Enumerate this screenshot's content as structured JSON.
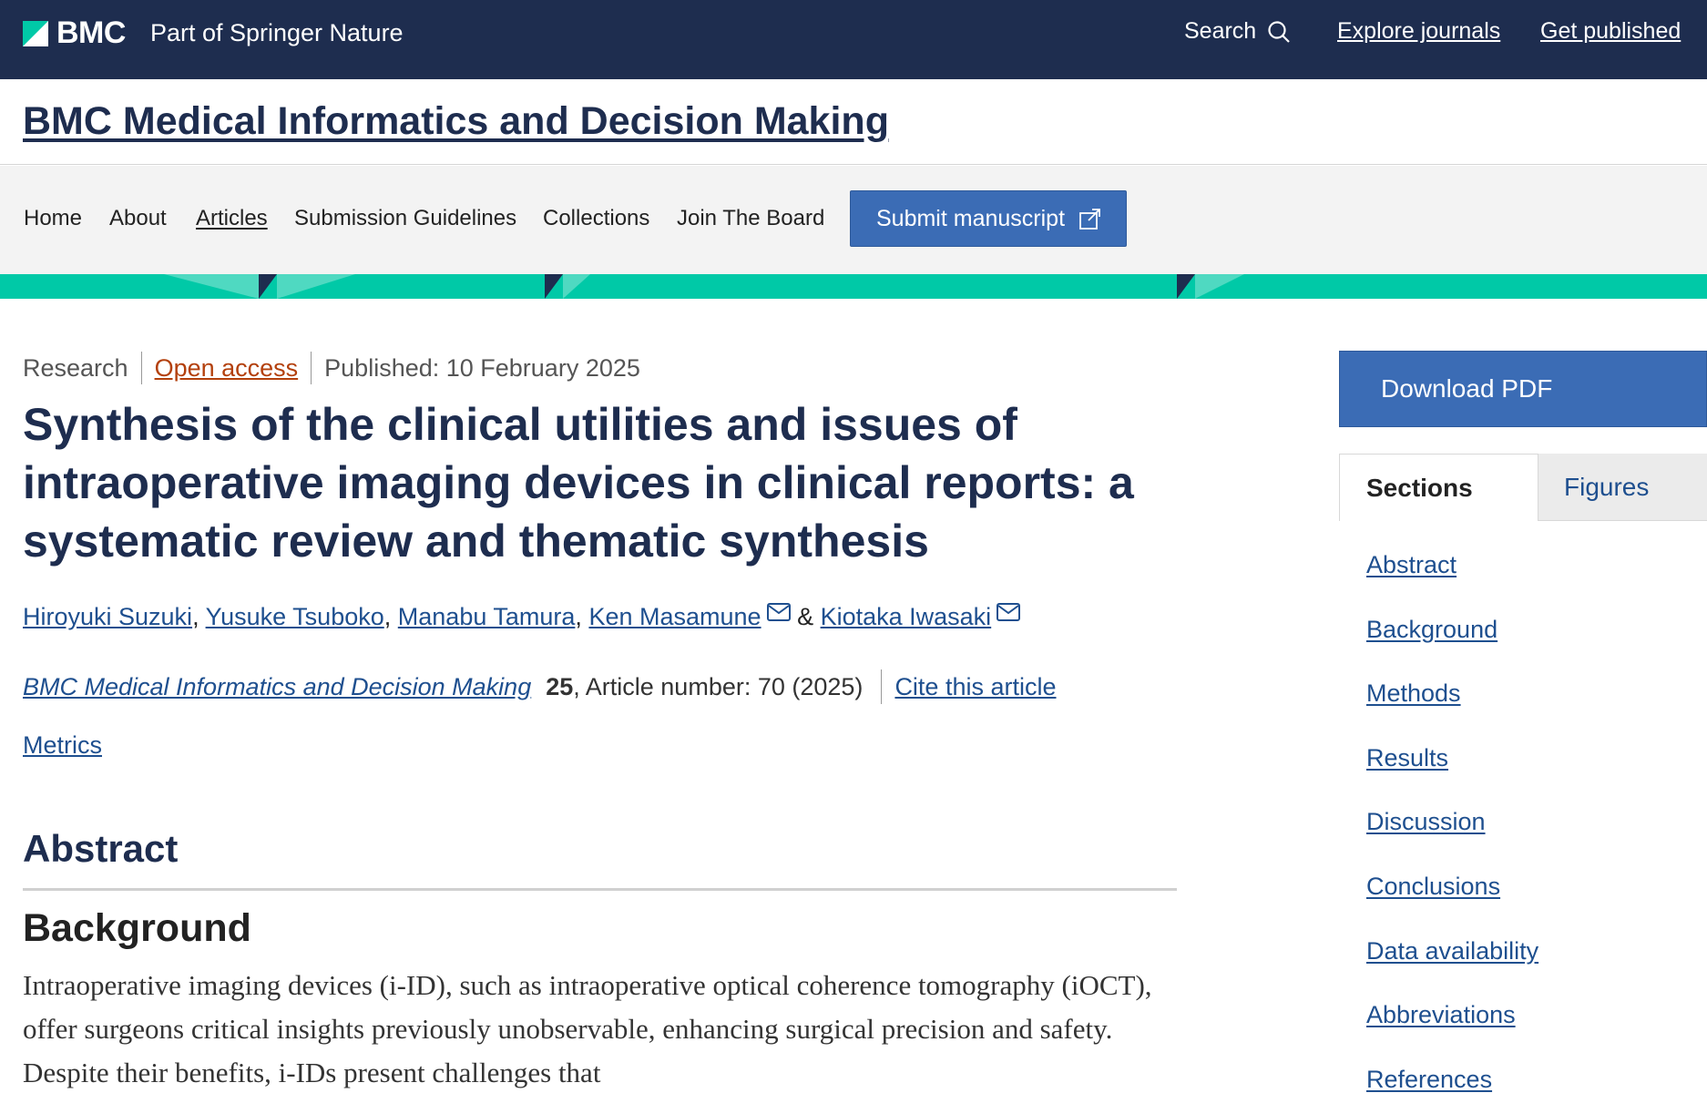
{
  "topbar": {
    "brand": "BMC",
    "tagline": "Part of Springer Nature",
    "search_label": "Search",
    "links": [
      "Explore journals",
      "Get published"
    ]
  },
  "journal": {
    "title": "BMC Medical Informatics and Decision Making"
  },
  "nav": {
    "items": [
      "Home",
      "About",
      "Articles",
      "Submission Guidelines",
      "Collections",
      "Join The Board"
    ],
    "active": "Articles",
    "submit_label": "Submit manuscript"
  },
  "article": {
    "type": "Research",
    "access": "Open access",
    "published": "Published: 10 February 2025",
    "title": "Synthesis of the clinical utilities and issues of intraoperative imaging devices in clinical reports: a systematic review and thematic synthesis",
    "authors": [
      "Hiroyuki Suzuki",
      "Yusuke Tsuboko",
      "Manabu Tamura",
      "Ken Masamune",
      "Kiotaka Iwasaki"
    ],
    "author_separator": ",",
    "author_conjunction": "&",
    "citation": {
      "journal": "BMC Medical Informatics and Decision Making",
      "volume": "25",
      "rest": ", Article number: 70 (2025)",
      "cite_label": "Cite this article"
    },
    "metrics_label": "Metrics"
  },
  "abstract": {
    "heading": "Abstract",
    "background_heading": "Background",
    "background_text": "Intraoperative imaging devices (i-ID), such as intraoperative optical coherence tomography (iOCT), offer surgeons critical insights previously unobservable, enhancing surgical precision and safety. Despite their benefits, i-IDs present challenges that"
  },
  "sidebar": {
    "download_label": "Download PDF",
    "tabs": [
      "Sections",
      "Figures"
    ],
    "sections": [
      "Abstract",
      "Background",
      "Methods",
      "Results",
      "Discussion",
      "Conclusions",
      "Data availability",
      "Abbreviations",
      "References"
    ]
  },
  "colors": {
    "header_navy": "#1e2d4f",
    "accent_teal": "#00c9a7",
    "button_blue": "#3b6cb5",
    "link_blue": "#1e4f8f",
    "open_access_orange": "#b3400c"
  }
}
